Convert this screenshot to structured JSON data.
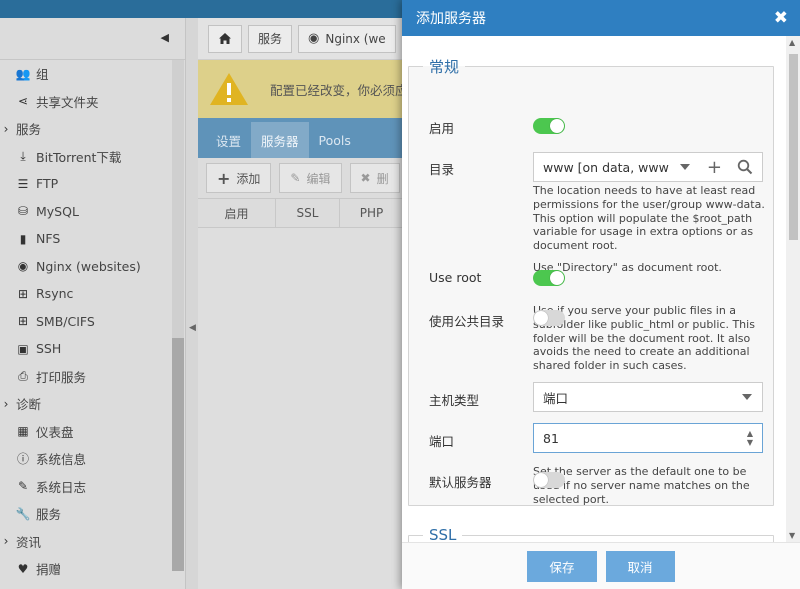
{
  "sidebar": {
    "items": [
      {
        "label": "组",
        "icon": "users-icon",
        "group": false
      },
      {
        "label": "共享文件夹",
        "icon": "share-icon",
        "group": false
      },
      {
        "label": "服务",
        "icon": "chevron-icon",
        "group": true
      },
      {
        "label": "BitTorrent下载",
        "icon": "download-icon",
        "group": false
      },
      {
        "label": "FTP",
        "icon": "ftp-icon",
        "group": false
      },
      {
        "label": "MySQL",
        "icon": "database-icon",
        "group": false
      },
      {
        "label": "NFS",
        "icon": "nfs-icon",
        "group": false
      },
      {
        "label": "Nginx (websites)",
        "icon": "globe-icon",
        "group": false
      },
      {
        "label": "Rsync",
        "icon": "sitemap-icon",
        "group": false
      },
      {
        "label": "SMB/CIFS",
        "icon": "windows-icon",
        "group": false
      },
      {
        "label": "SSH",
        "icon": "terminal-icon",
        "group": false
      },
      {
        "label": "打印服务",
        "icon": "printer-icon",
        "group": false
      },
      {
        "label": "诊断",
        "icon": "chevron-icon",
        "group": true
      },
      {
        "label": "仪表盘",
        "icon": "dashboard-icon",
        "group": false
      },
      {
        "label": "系统信息",
        "icon": "info-icon",
        "group": false
      },
      {
        "label": "系统日志",
        "icon": "edit-icon",
        "group": false
      },
      {
        "label": "服务",
        "icon": "wrench-icon",
        "group": false
      },
      {
        "label": "资讯",
        "icon": "chevron-icon",
        "group": true
      },
      {
        "label": "捐赠",
        "icon": "heart-icon",
        "group": false
      }
    ]
  },
  "breadcrumb": {
    "home_icon": "home-icon",
    "item1": "服务",
    "item2": "Nginx (we"
  },
  "alert": {
    "text": "配置已经改变，你必须应"
  },
  "tabs": [
    "设置",
    "服务器",
    "Pools"
  ],
  "toolbar": {
    "add": "添加",
    "edit": "编辑",
    "delete": "删"
  },
  "table": {
    "columns": [
      "启用",
      "SSL",
      "PHP"
    ]
  },
  "modal": {
    "title": "添加服务器",
    "close": "✖",
    "general_legend": "常规",
    "enabled_label": "启用",
    "enabled": true,
    "directory_label": "目录",
    "directory_value": "www [on data, www",
    "directory_help": "The location needs to have at least read permissions for the user/group www-data. This option will populate the $root_path variable for usage in extra options or as document root.",
    "use_root_help_top": "Use \"Directory\" as document root.",
    "use_root_label": "Use root",
    "use_root": true,
    "public_dir_label": "使用公共目录",
    "public_dir": false,
    "public_dir_help": "Use if you serve your public files in a subfolder like public_html or public. This folder will be the document root. It also avoids the need to create an additional shared folder in such cases.",
    "host_type_label": "主机类型",
    "host_type_value": "端口",
    "port_label": "端口",
    "port_value": "81",
    "default_server_label": "默认服务器",
    "default_server": false,
    "default_server_help": "Set the server as the default one to be used if no server name matches on the selected port.",
    "ssl_legend": "SSL",
    "save": "保存",
    "cancel": "取消"
  },
  "colors": {
    "modal_header": "#2f7fc1",
    "toggle_on": "#4cc74f",
    "button": "#6ba9dd",
    "legend": "#2f6fa8"
  }
}
